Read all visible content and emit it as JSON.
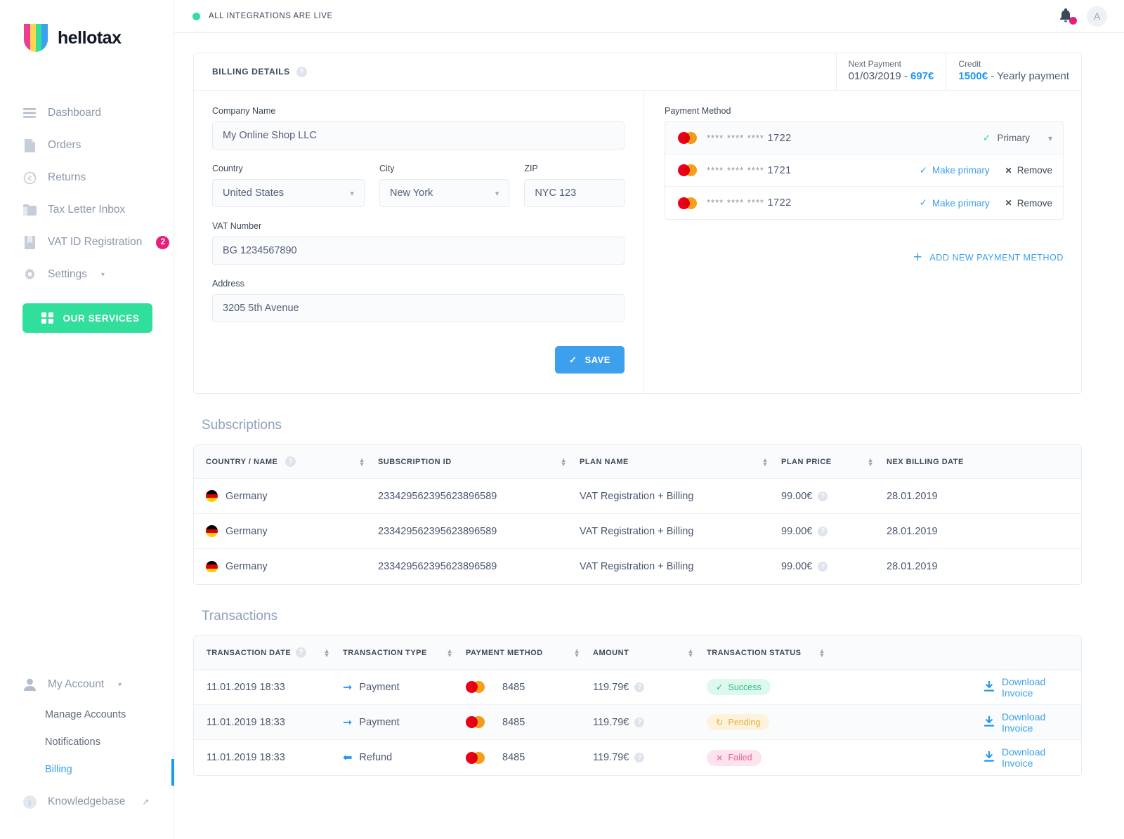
{
  "brand": {
    "name": "hellotax",
    "accent": "#2fdf9b",
    "link": "#3da0ec",
    "badge": "#e91e78"
  },
  "sidebar": {
    "nav": [
      {
        "label": "Dashboard",
        "icon": "menu-icon",
        "badge": null
      },
      {
        "label": "Orders",
        "icon": "document-icon",
        "badge": null
      },
      {
        "label": "Returns",
        "icon": "euro-refresh-icon",
        "badge": null
      },
      {
        "label": "Tax Letter Inbox",
        "icon": "folder-icon",
        "badge": null
      },
      {
        "label": "VAT ID Registration",
        "icon": "bookmark-icon",
        "badge": "2"
      },
      {
        "label": "Settings",
        "icon": "gear-icon",
        "badge": null,
        "caret": true
      }
    ],
    "services_button": "OUR SERVICES",
    "account": {
      "label": "My Account",
      "icon": "user-icon"
    },
    "account_items": [
      {
        "label": "Manage Accounts",
        "active": false
      },
      {
        "label": "Notifications",
        "active": false
      },
      {
        "label": "Billing",
        "active": true
      }
    ],
    "knowledgebase": {
      "label": "Knowledgebase",
      "icon": "info-icon",
      "external": "↗"
    }
  },
  "topbar": {
    "status": "ALL INTEGRATIONS ARE LIVE",
    "avatar_initial": "A"
  },
  "billing": {
    "title": "BILLING DETAILS",
    "next_payment": {
      "label": "Next Payment",
      "date": "01/03/2019 - ",
      "amount": "697€"
    },
    "credit": {
      "label": "Credit",
      "amount": "1500€",
      "suffix": " - Yearly payment"
    },
    "form": {
      "company_label": "Company Name",
      "company_value": "My Online Shop LLC",
      "country_label": "Country",
      "country_value": "United States",
      "city_label": "City",
      "city_value": "New York",
      "zip_label": "ZIP",
      "zip_value": "NYC 123",
      "vat_label": "VAT Number",
      "vat_value": "BG 1234567890",
      "address_label": "Address",
      "address_value": "3205 5th Avenue",
      "save_label": "SAVE"
    },
    "payment": {
      "label": "Payment Method",
      "methods": [
        {
          "stars": "**** **** ****",
          "last4": "1722",
          "state": "primary",
          "primary_label": "Primary"
        },
        {
          "stars": "**** **** ****",
          "last4": "1721",
          "state": "other",
          "make_primary": "Make primary",
          "remove": "Remove"
        },
        {
          "stars": "**** **** ****",
          "last4": "1722",
          "state": "other",
          "make_primary": "Make primary",
          "remove": "Remove"
        }
      ],
      "add_label": "ADD NEW PAYMENT METHOD"
    }
  },
  "subscriptions": {
    "title": "Subscriptions",
    "columns": [
      "COUNTRY / NAME",
      "SUBSCRIPTION ID",
      "PLAN NAME",
      "PLAN PRICE",
      "NEX BILLING DATE"
    ],
    "rows": [
      {
        "country": "Germany",
        "id": "233429562395623896589",
        "plan": "VAT Registration + Billing",
        "price": "99.00€",
        "next": "28.01.2019"
      },
      {
        "country": "Germany",
        "id": "233429562395623896589",
        "plan": "VAT Registration + Billing",
        "price": "99.00€",
        "next": "28.01.2019"
      },
      {
        "country": "Germany",
        "id": "233429562395623896589",
        "plan": "VAT Registration + Billing",
        "price": "99.00€",
        "next": "28.01.2019"
      }
    ]
  },
  "transactions": {
    "title": "Transactions",
    "columns": [
      "TRANSACTION DATE",
      "TRANSACTION TYPE",
      "PAYMENT METHOD",
      "AMOUNT",
      "TRANSACTION STATUS"
    ],
    "download_label": "Download Invoice",
    "rows": [
      {
        "date": "11.01.2019  18:33",
        "type": "Payment",
        "dir": "out",
        "card": "8485",
        "amount": "119.79€",
        "status": "Success",
        "status_kind": "success"
      },
      {
        "date": "11.01.2019  18:33",
        "type": "Payment",
        "dir": "out",
        "card": "8485",
        "amount": "119.79€",
        "status": "Pending",
        "status_kind": "pending"
      },
      {
        "date": "11.01.2019  18:33",
        "type": "Refund",
        "dir": "in",
        "card": "8485",
        "amount": "119.79€",
        "status": "Failed",
        "status_kind": "failed"
      }
    ]
  }
}
